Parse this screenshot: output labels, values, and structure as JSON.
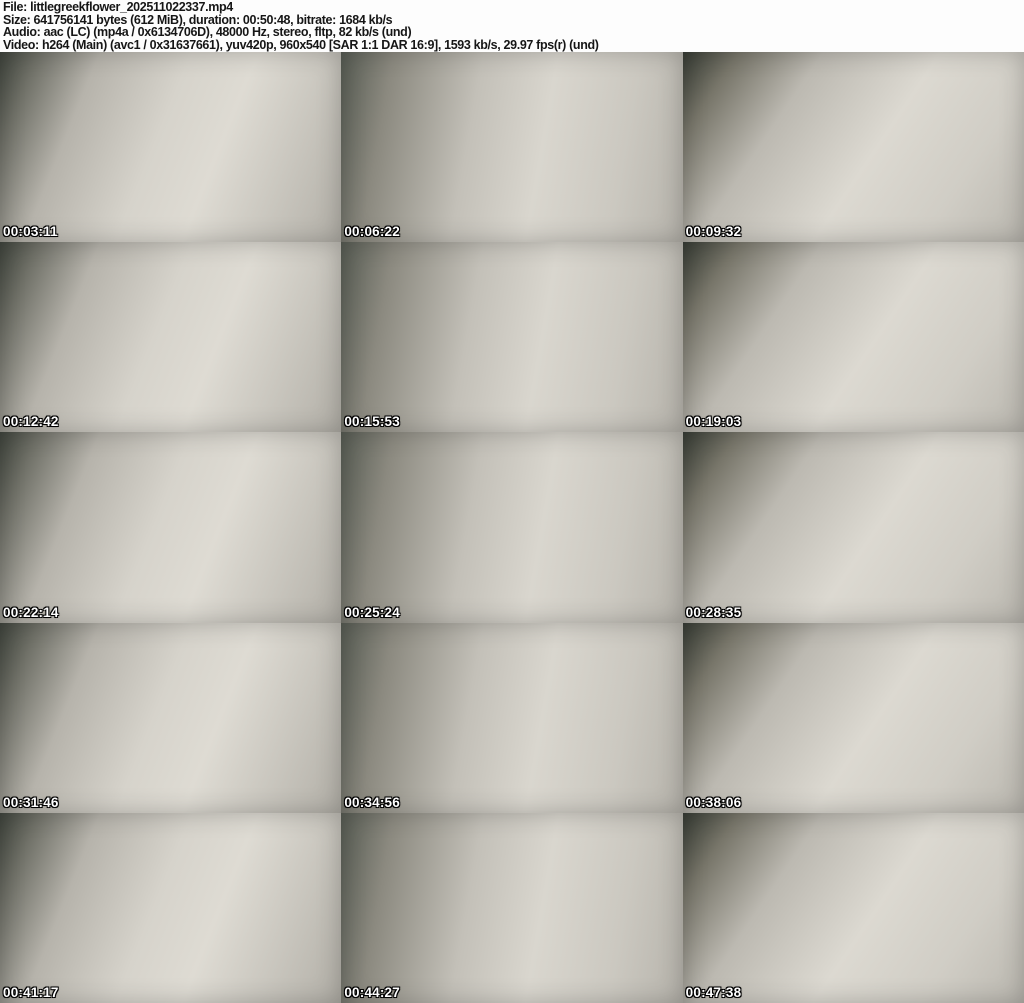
{
  "header": {
    "file_line": "File: littlegreekflower_202511022337.mp4",
    "size_line": "Size: 641756141 bytes (612 MiB), duration: 00:50:48, bitrate: 1684 kb/s",
    "audio_line": "Audio: aac (LC) (mp4a / 0x6134706D), 48000 Hz, stereo, fltp, 82 kb/s (und)",
    "video_line": "Video: h264 (Main) (avc1 / 0x31637661), yuv420p, 960x540 [SAR 1:1 DAR 16:9], 1593 kb/s, 29.97 fps(r) (und)"
  },
  "colors": {
    "header_bg": "#fdfdfd",
    "header_text": "#161616",
    "timestamp_text": "#ffffff",
    "timestamp_outline": "#000000"
  },
  "grid": {
    "columns": 3,
    "rows": 5
  },
  "thumbnails": [
    {
      "timestamp": "00:03:11"
    },
    {
      "timestamp": "00:06:22"
    },
    {
      "timestamp": "00:09:32"
    },
    {
      "timestamp": "00:12:42"
    },
    {
      "timestamp": "00:15:53"
    },
    {
      "timestamp": "00:19:03"
    },
    {
      "timestamp": "00:22:14"
    },
    {
      "timestamp": "00:25:24"
    },
    {
      "timestamp": "00:28:35"
    },
    {
      "timestamp": "00:31:46"
    },
    {
      "timestamp": "00:34:56"
    },
    {
      "timestamp": "00:38:06"
    },
    {
      "timestamp": "00:41:17"
    },
    {
      "timestamp": "00:44:27"
    },
    {
      "timestamp": "00:47:38"
    }
  ]
}
